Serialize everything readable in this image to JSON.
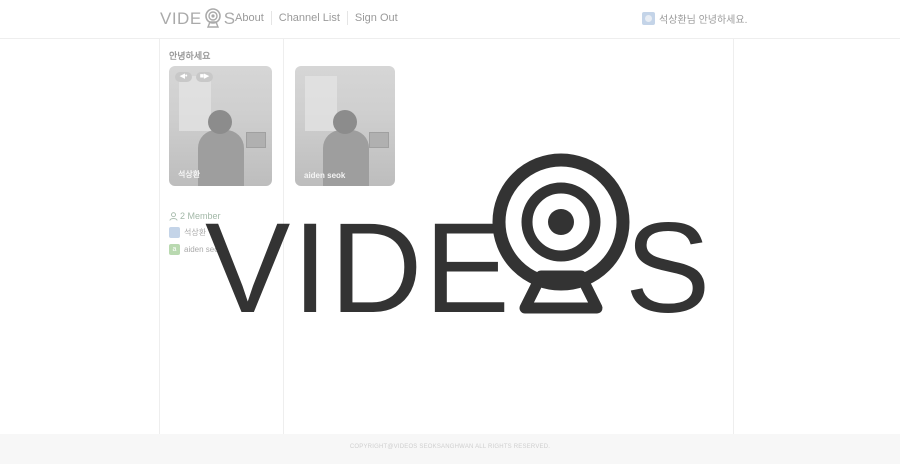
{
  "header": {
    "logo_text_left": "VIDE",
    "logo_text_right": "S",
    "nav": [
      {
        "label": "About"
      },
      {
        "label": "Channel List"
      },
      {
        "label": "Sign Out"
      }
    ],
    "greeting": "석상환님 안녕하세요."
  },
  "room": {
    "title": "안녕하세요",
    "tiles": [
      {
        "name": "석상환",
        "controls": [
          "◀•",
          "■▶"
        ]
      },
      {
        "name": "aiden seok"
      }
    ]
  },
  "members": {
    "count_label": "2 Member",
    "list": [
      {
        "name": "석상환",
        "avatar": "avatar-icon"
      },
      {
        "name": "aiden seok",
        "avatar": "a"
      }
    ]
  },
  "overlay": {
    "logo_left": "VIDE",
    "logo_right": "S"
  },
  "footer": {
    "copyright": "COPYRIGHT@VIDEOS SEOKSANGHWAN ALL RIGHTS RESERVED."
  },
  "colors": {
    "logo": "#333333",
    "muted": "#999999",
    "footer_bg": "#f7f7f7"
  }
}
